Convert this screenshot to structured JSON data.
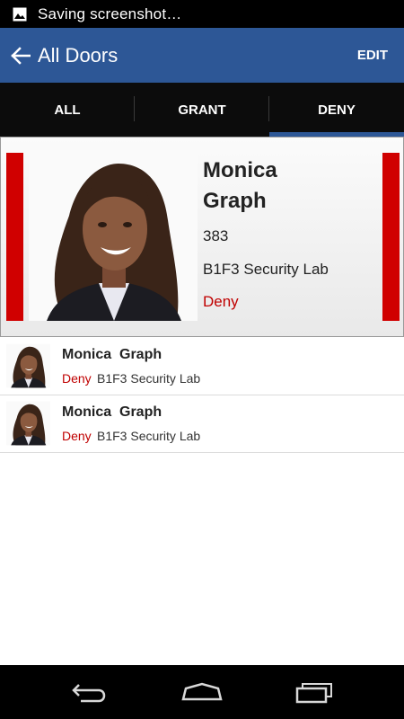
{
  "status_bar": {
    "notification_icon": "image-icon",
    "text": "Saving screenshot…"
  },
  "app_bar": {
    "back_icon": "arrow-left-icon",
    "title": "All Doors",
    "edit_label": "EDIT"
  },
  "tabs": [
    {
      "label": "ALL",
      "active": false
    },
    {
      "label": "GRANT",
      "active": false
    },
    {
      "label": "DENY",
      "active": true
    }
  ],
  "detail": {
    "first_name": "Monica",
    "last_name": "Graph",
    "id": "383",
    "location": "B1F3 Security Lab",
    "status": "Deny",
    "status_color": "#c00000",
    "indicator_color": "#d00000"
  },
  "events": [
    {
      "name": "Monica  Graph",
      "status": "Deny",
      "location": "B1F3 Security Lab"
    },
    {
      "name": "Monica  Graph",
      "status": "Deny",
      "location": "B1F3 Security Lab"
    }
  ],
  "nav_bar": {
    "back_icon": "nav-back-icon",
    "home_icon": "nav-home-icon",
    "recents_icon": "nav-recents-icon"
  },
  "colors": {
    "primary": "#2d5796",
    "tab_bg": "#0c0c0c",
    "deny": "#c00000"
  }
}
